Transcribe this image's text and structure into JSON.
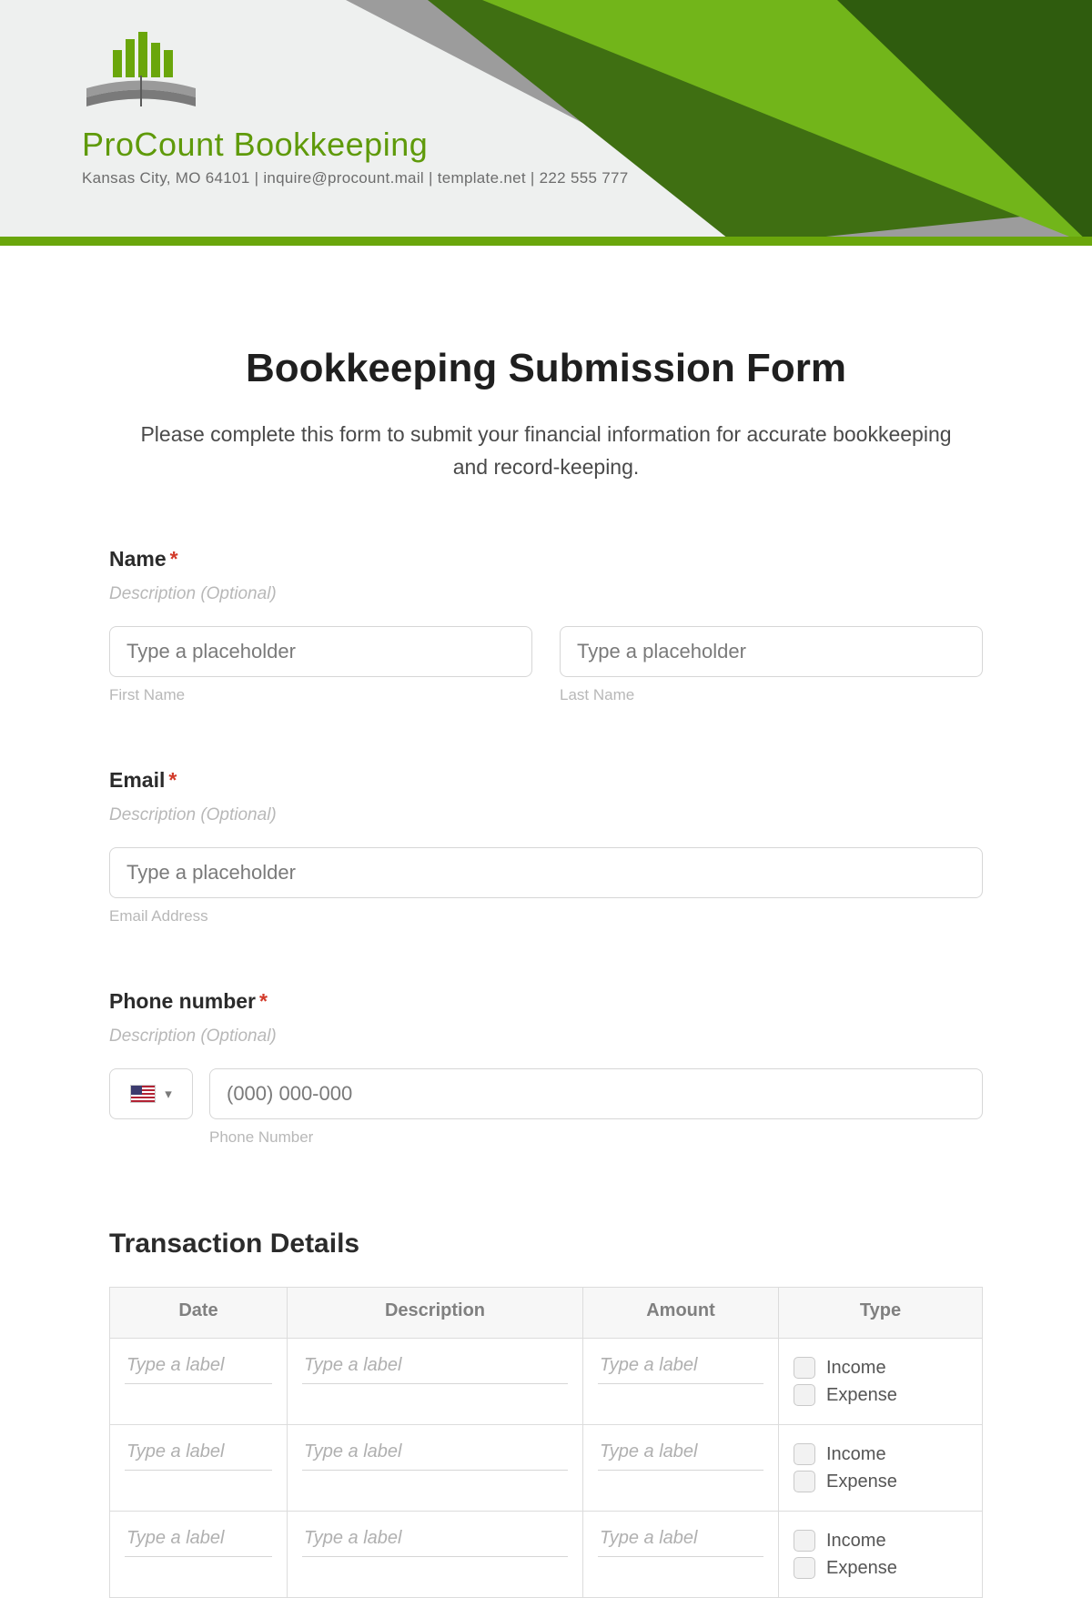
{
  "brand": {
    "name": "ProCount Bookkeeping",
    "meta": "Kansas City, MO 64101 | inquire@procount.mail | template.net | 222 555 777"
  },
  "form": {
    "title": "Bookkeeping Submission Form",
    "intro": "Please complete this form to submit your financial information for accurate bookkeeping and record-keeping."
  },
  "name": {
    "label": "Name",
    "required_mark": "*",
    "description": "Description (Optional)",
    "first_placeholder": "Type a placeholder",
    "first_sub": "First Name",
    "last_placeholder": "Type a placeholder",
    "last_sub": "Last Name"
  },
  "email": {
    "label": "Email",
    "required_mark": "*",
    "description": "Description (Optional)",
    "placeholder": "Type a placeholder",
    "sub": "Email Address"
  },
  "phone": {
    "label": "Phone number",
    "required_mark": "*",
    "description": "Description (Optional)",
    "placeholder": "(000) 000-000",
    "sub": "Phone Number"
  },
  "transactions": {
    "section_title": "Transaction Details",
    "columns": {
      "date": "Date",
      "description": "Description",
      "amount": "Amount",
      "type": "Type"
    },
    "cell_placeholder": "Type a label",
    "type_options": {
      "income": "Income",
      "expense": "Expense"
    },
    "row_count": 3
  }
}
